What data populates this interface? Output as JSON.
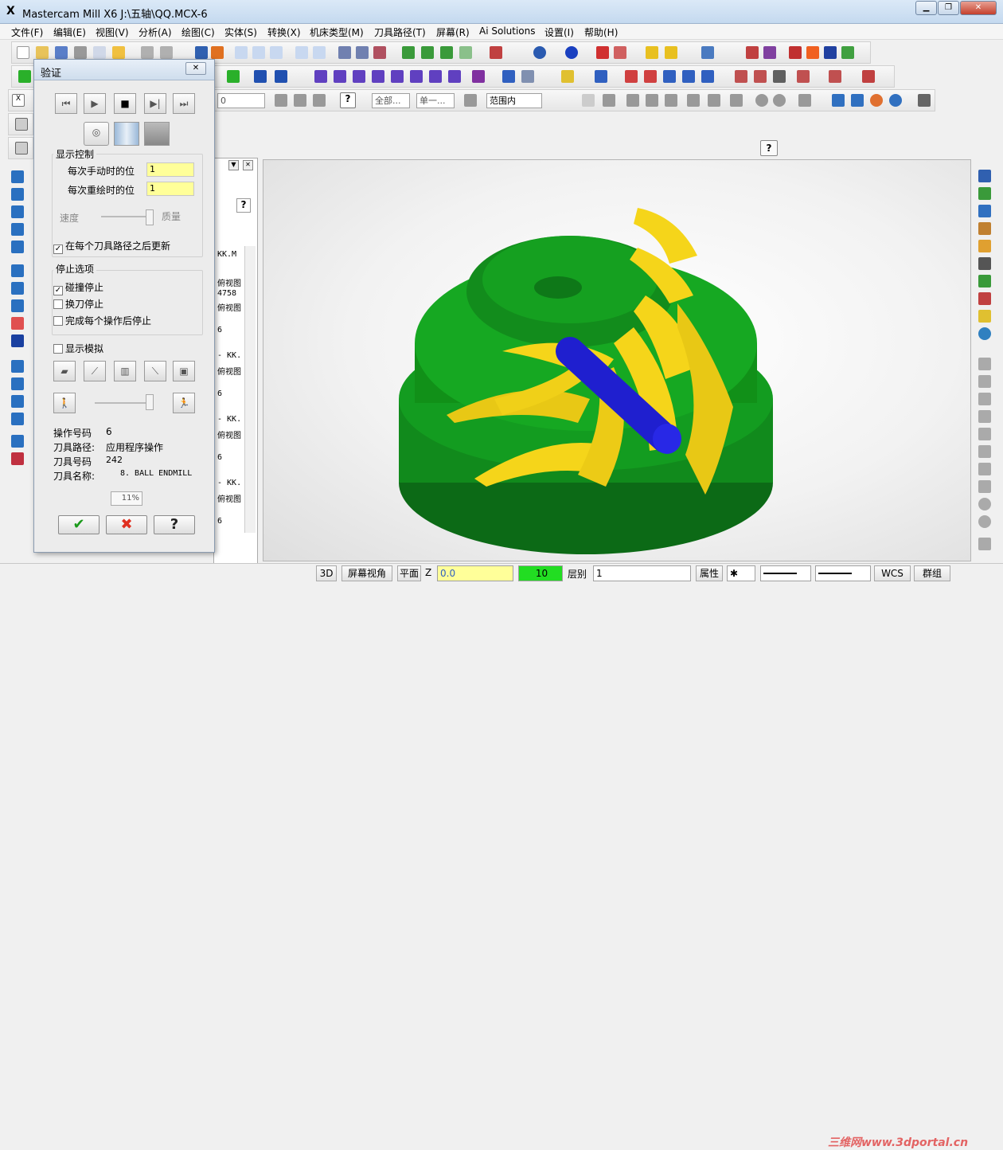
{
  "window": {
    "title": "Mastercam Mill X6  J:\\五轴\\QQ.MCX-6",
    "min": "▁",
    "max": "❐",
    "close": "✕"
  },
  "menu": [
    "文件(F)",
    "编辑(E)",
    "视图(V)",
    "分析(A)",
    "绘图(C)",
    "实体(S)",
    "转换(X)",
    "机床类型(M)",
    "刀具路径(T)",
    "屏幕(R)",
    "Ai Solutions",
    "设置(I)",
    "帮助(H)"
  ],
  "toolbar": {
    "combo_value": "0",
    "combo_all": "全部...",
    "combo_single": "单一...",
    "combo_range": "范围内",
    "help_glyph": "?"
  },
  "ops_panel": {
    "lines": [
      "KK.M",
      "俯视图",
      "4758",
      "俯视图",
      "6",
      "- KK.",
      "俯视图",
      "6",
      "- KK.",
      "俯视图",
      "6",
      "- KK.",
      "俯视图",
      "6"
    ]
  },
  "dialog": {
    "title": "验证",
    "close": "✕",
    "playback": {
      "first": "⏮",
      "play": "▶",
      "stop": "■",
      "step": "▶|",
      "fast": "⏭"
    },
    "display_control": {
      "label": "显示控制",
      "manual_label": "每次手动时的位",
      "manual_value": "1",
      "redraw_label": "每次重绘时的位",
      "redraw_value": "1",
      "speed": "速度",
      "quality": "质量",
      "update_after_each": "在每个刀具路径之后更新",
      "update_checked": "✓"
    },
    "stop_options": {
      "label": "停止选项",
      "collision": "碰撞停止",
      "collision_checked": "✓",
      "tool_change": "换刀停止",
      "after_each_op": "完成每个操作后停止"
    },
    "show_sim": "显示模拟",
    "info": {
      "op_num_label": "操作号码",
      "op_num": "6",
      "path_label": "刀具路径:",
      "path": "应用程序操作",
      "tool_num_label": "刀具号码",
      "tool_num": "242",
      "tool_name_label": "刀具名称:",
      "tool_name": "8. BALL ENDMILL"
    },
    "progress": "11%",
    "ok": "✔",
    "cancel": "✖",
    "help": "?"
  },
  "status": {
    "btn_3d": "3D",
    "screen_view": "屏幕视角",
    "plane": "平面",
    "z_label": "Z",
    "z_value": "0.0",
    "color_value": "10",
    "layer_label": "层别",
    "layer_value": "1",
    "attr": "属性",
    "wcs": "WCS",
    "group": "群组",
    "watermark": "三维网www.3dportal.cn"
  },
  "colors": {
    "green": "#128a1e",
    "yellow": "#f5d51a",
    "blue": "#1f1fcf",
    "hilite": "#ffff99",
    "status_green": "#22dd22"
  },
  "icons": [
    "new-icon",
    "open-icon",
    "save-icon",
    "print-icon",
    "undo-icon",
    "redo-icon",
    "zoom-icon",
    "gear-icon",
    "cube-icon",
    "sphere-icon",
    "ruler-icon",
    "help-icon",
    "wcs-icon"
  ]
}
